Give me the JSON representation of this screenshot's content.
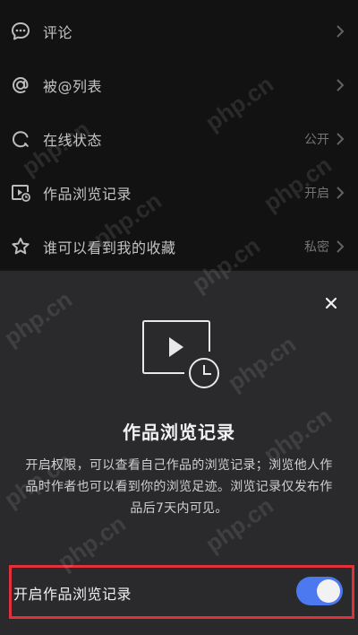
{
  "settings": {
    "items": [
      {
        "label": "评论",
        "value": "",
        "icon": "comment-icon"
      },
      {
        "label": "被@列表",
        "value": "",
        "icon": "at-icon"
      },
      {
        "label": "在线状态",
        "value": "公开",
        "icon": "online-status-icon"
      },
      {
        "label": "作品浏览记录",
        "value": "开启",
        "icon": "video-clock-icon"
      },
      {
        "label": "谁可以看到我的收藏",
        "value": "私密",
        "icon": "star-icon"
      }
    ]
  },
  "sheet": {
    "close_icon": "close-icon",
    "illustration_icon": "video-clock-icon",
    "title": "作品浏览记录",
    "description": "开启权限，可以查看自己作品的浏览记录；浏览他人作品时作者也可以看到你的浏览足迹。浏览记录仅发布作品后7天内可见。",
    "toggle_label": "开启作品浏览记录",
    "toggle_on": true
  },
  "watermark": "php.cn",
  "colors": {
    "background": "#161616",
    "sheet_background": "#2a2a2c",
    "toggle_on": "#4d79f0",
    "highlight_border": "#e0303a"
  }
}
